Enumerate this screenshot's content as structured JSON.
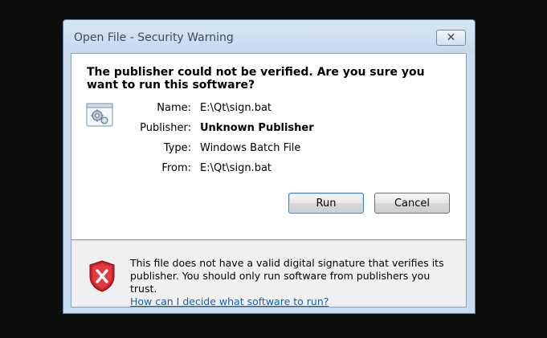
{
  "window": {
    "title": "Open File - Security Warning",
    "close_symbol": "✕"
  },
  "dialog": {
    "heading": "The publisher could not be verified.  Are you sure you want to run this software?",
    "fields": [
      {
        "label": "Name:",
        "value": "E:\\Qt\\sign.bat",
        "bold": false
      },
      {
        "label": "Publisher:",
        "value": "Unknown Publisher",
        "bold": true
      },
      {
        "label": "Type:",
        "value": "Windows Batch File",
        "bold": false
      },
      {
        "label": "From:",
        "value": "E:\\Qt\\sign.bat",
        "bold": false
      }
    ],
    "buttons": {
      "run": "Run",
      "cancel": "Cancel"
    }
  },
  "warning": {
    "text": "This file does not have a valid digital signature that verifies its publisher.  You should only run software from publishers you trust.",
    "link": "How can I decide what software to run?"
  },
  "icons": {
    "file": "batch-file-gear-icon",
    "shield": "red-shield-x-icon",
    "close": "close-icon"
  }
}
